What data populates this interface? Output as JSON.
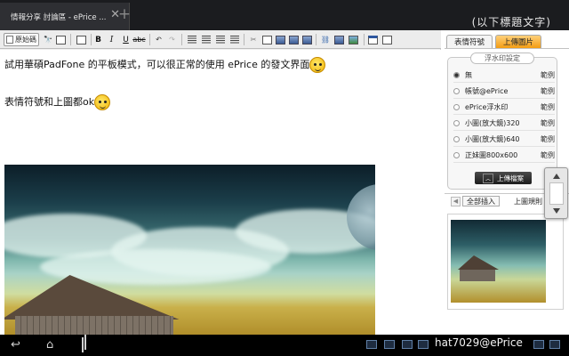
{
  "browser": {
    "tab_title": "情報分享 討論區 - ePrice ...",
    "tab_close": "✕",
    "new_tab": "+",
    "behind_text": "(以下標題文字)"
  },
  "toolbar": {
    "source_label": "原始碼"
  },
  "editor": {
    "line1": "試用華碩PadFone 的平板模式，可以很正常的使用 ePrice 的發文界面",
    "line2": "表情符號和上圖都ok"
  },
  "panel": {
    "tab_emoticons": "表情符號",
    "tab_upload": "上傳圖片",
    "watermark_heading": "浮水印設定",
    "options": [
      {
        "label": "無",
        "example": "範例",
        "selected": true
      },
      {
        "label": "帳號@ePrice",
        "example": "範例",
        "selected": false
      },
      {
        "label": "ePrice浮水印",
        "example": "範例",
        "selected": false
      },
      {
        "label": "小圖(放大鏡)320",
        "example": "範例",
        "selected": false
      },
      {
        "label": "小圖(放大鏡)640",
        "example": "範例",
        "selected": false
      },
      {
        "label": "正妹圖800x600",
        "example": "範例",
        "selected": false
      }
    ],
    "upload_button": "上傳檔案",
    "insert_all": "全部插入",
    "upload_rule": "上圖規則"
  },
  "system": {
    "watermark": "hat7029@ePrice"
  }
}
